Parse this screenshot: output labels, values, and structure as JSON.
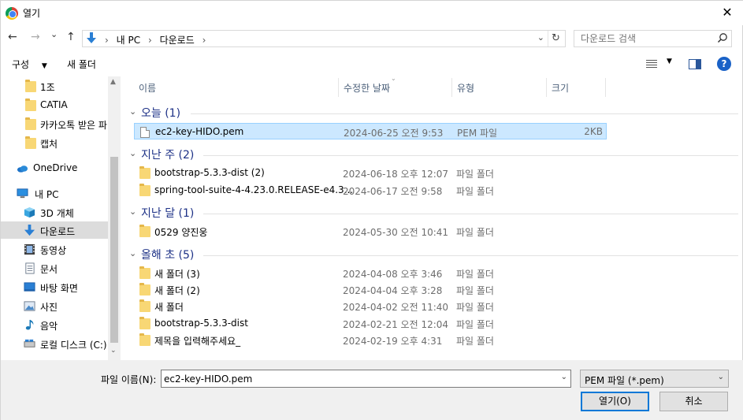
{
  "window": {
    "title": "열기",
    "close_glyph": "✕"
  },
  "nav_buttons": {
    "back": "←",
    "forward": "→",
    "recent": "⌄",
    "up": "↑"
  },
  "address": {
    "crumbs": [
      "내 PC",
      "›",
      "다운로드",
      "›"
    ],
    "dropdown_glyph": "⌄",
    "refresh_glyph": "↻"
  },
  "search": {
    "placeholder": "다운로드 검색",
    "icon": "search-icon"
  },
  "toolbar": {
    "organize_label": "구성",
    "organize_caret": "▼",
    "new_folder_label": "새 폴더",
    "view_caret": "▼",
    "help_label": "?"
  },
  "nav": {
    "items": [
      {
        "label": "1조",
        "icon": "folder-icon"
      },
      {
        "label": "CATIA",
        "icon": "folder-icon"
      },
      {
        "label": "카카오톡 받은 파",
        "icon": "folder-icon"
      },
      {
        "label": "캡처",
        "icon": "folder-icon"
      },
      {
        "label": "OneDrive",
        "icon": "onedrive-icon"
      },
      {
        "label": "내 PC",
        "icon": "pc-icon"
      },
      {
        "label": "3D 개체",
        "icon": "3d-objects-icon"
      },
      {
        "label": "다운로드",
        "icon": "downloads-icon"
      },
      {
        "label": "동영상",
        "icon": "videos-icon"
      },
      {
        "label": "문서",
        "icon": "documents-icon"
      },
      {
        "label": "바탕 화면",
        "icon": "desktop-icon"
      },
      {
        "label": "사진",
        "icon": "pictures-icon"
      },
      {
        "label": "음악",
        "icon": "music-icon"
      },
      {
        "label": "로컬 디스크 (C:)",
        "icon": "drive-icon"
      }
    ],
    "selected": "다운로드"
  },
  "columns": {
    "name": "이름",
    "date": "수정한 날짜",
    "type": "유형",
    "size": "크기"
  },
  "groups": [
    {
      "name": "오늘 (1)",
      "files": [
        {
          "name": "ec2-key-HIDO.pem",
          "date": "2024-06-25 오전 9:53",
          "type": "PEM 파일",
          "size": "2KB",
          "icon": "pem-file-icon",
          "selected": true
        }
      ]
    },
    {
      "name": "지난 주 (2)",
      "files": [
        {
          "name": "bootstrap-5.3.3-dist (2)",
          "date": "2024-06-18 오후 12:07",
          "type": "파일 폴더",
          "size": "",
          "icon": "folder-icon"
        },
        {
          "name": "spring-tool-suite-4-4.23.0.RELEASE-e4.3...",
          "date": "2024-06-17 오전 9:58",
          "type": "파일 폴더",
          "size": "",
          "icon": "folder-icon"
        }
      ]
    },
    {
      "name": "지난 달 (1)",
      "files": [
        {
          "name": "0529 양진웅",
          "date": "2024-05-30 오전 10:41",
          "type": "파일 폴더",
          "size": "",
          "icon": "folder-icon"
        }
      ]
    },
    {
      "name": "올해 초 (5)",
      "files": [
        {
          "name": "새 폴더 (3)",
          "date": "2024-04-08 오후 3:46",
          "type": "파일 폴더",
          "size": "",
          "icon": "folder-icon"
        },
        {
          "name": "새 폴더 (2)",
          "date": "2024-04-04 오후 3:28",
          "type": "파일 폴더",
          "size": "",
          "icon": "folder-icon"
        },
        {
          "name": "새 폴더",
          "date": "2024-04-02 오전 11:40",
          "type": "파일 폴더",
          "size": "",
          "icon": "folder-icon"
        },
        {
          "name": "bootstrap-5.3.3-dist",
          "date": "2024-02-21 오전 12:04",
          "type": "파일 폴더",
          "size": "",
          "icon": "folder-icon"
        },
        {
          "name": "제목을 입력해주세요_",
          "date": "2024-02-19 오후 4:31",
          "type": "파일 폴더",
          "size": "",
          "icon": "folder-icon"
        }
      ]
    }
  ],
  "footer": {
    "filename_label": "파일 이름(N):",
    "filename_value": "ec2-key-HIDO.pem",
    "filetype_value": "PEM 파일 (*.pem)",
    "open_label": "열기(O)",
    "cancel_label": "취소"
  },
  "colors": {
    "selection": "#cce8ff",
    "group_header": "#1e3287",
    "accent": "#0078d7"
  }
}
